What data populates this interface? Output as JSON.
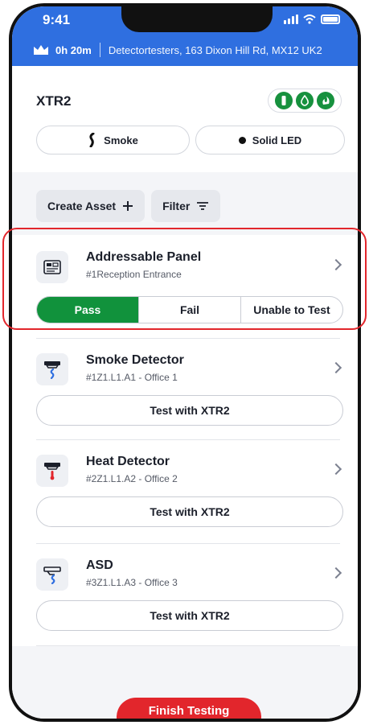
{
  "status_bar": {
    "time": "9:41"
  },
  "banner": {
    "duration": "0h 20m",
    "location": "Detectortesters, 163 Dixon Hill Rd, MX12 UK2"
  },
  "device": {
    "name": "XTR2",
    "mode_label": "Smoke",
    "led_label": "Solid LED",
    "status_icons": [
      "battery-icon",
      "smoke-drop-icon",
      "heat-icon"
    ],
    "status_color": "#17913e"
  },
  "actions": {
    "create_label": "Create Asset",
    "filter_label": "Filter"
  },
  "assets": [
    {
      "name": "Addressable Panel",
      "subtitle": "#1Reception Entrance",
      "icon": "panel-icon",
      "options": [
        "Pass",
        "Fail",
        "Unable to Test"
      ],
      "selected": "Pass"
    },
    {
      "name": "Smoke Detector",
      "subtitle": "#1Z1.L1.A1 - Office 1",
      "icon": "smoke-detector-icon",
      "button": "Test with XTR2"
    },
    {
      "name": "Heat Detector",
      "subtitle": "#2Z1.L1.A2 - Office 2",
      "icon": "heat-detector-icon",
      "button": "Test with XTR2"
    },
    {
      "name": "ASD",
      "subtitle": "#3Z1.L1.A3 - Office 3",
      "icon": "asd-icon",
      "button": "Test with XTR2"
    }
  ],
  "footer": {
    "finish_label": "Finish Testing"
  },
  "colors": {
    "accent_blue": "#2f6fe0",
    "pass_green": "#11923c",
    "alert_red": "#e2262c"
  }
}
